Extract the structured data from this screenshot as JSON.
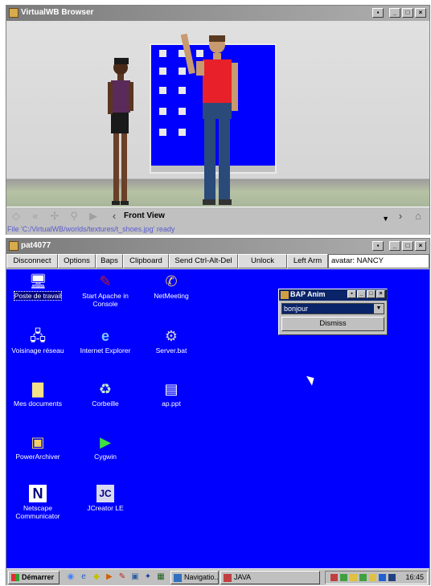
{
  "top_window": {
    "title": "VirtualWB Browser",
    "view_select": "Front View",
    "status": "File 'C:/VirtualWB/worlds/textures/t_shoes.jpg' ready"
  },
  "vnc_window": {
    "title": "pat4077",
    "toolbar": {
      "disconnect": "Disconnect",
      "options": "Options",
      "baps": "Baps",
      "clipboard": "Clipboard",
      "send_cad": "Send Ctrl-Alt-Del",
      "unlock": "Unlock",
      "left_arm": "Left Arm",
      "avatar_field": "avatar: NANCY"
    }
  },
  "desktop": {
    "icons": [
      {
        "label": "Poste de travail",
        "icon": "computer-icon"
      },
      {
        "label": "Start Apache in Console",
        "icon": "feather-icon"
      },
      {
        "label": "NetMeeting",
        "icon": "netmeeting-icon"
      },
      {
        "label": "Voisinage réseau",
        "icon": "network-icon"
      },
      {
        "label": "Internet Explorer",
        "icon": "ie-icon"
      },
      {
        "label": "Server.bat",
        "icon": "bat-icon"
      },
      {
        "label": "Mes documents",
        "icon": "folder-icon"
      },
      {
        "label": "Corbeille",
        "icon": "recycle-bin-icon"
      },
      {
        "label": "ap.ppt",
        "icon": "document-icon"
      },
      {
        "label": "PowerArchiver",
        "icon": "archive-icon"
      },
      {
        "label": "Cygwin",
        "icon": "cygwin-icon"
      },
      {
        "label": "Netscape Communicator",
        "icon": "netscape-icon"
      },
      {
        "label": "JCreator LE",
        "icon": "jcreator-icon"
      }
    ]
  },
  "bap_dialog": {
    "title": "BAP Anim",
    "selected": "bonjour",
    "dismiss": "Dismiss"
  },
  "taskbar": {
    "start": "Démarrer",
    "tasks": [
      "Navigatio...",
      "JAVA"
    ],
    "clock": "16:45"
  },
  "colors": {
    "desktop_blue": "#0000ff",
    "dialog_title": "#0a246a",
    "status_text": "#5a5ad0"
  }
}
